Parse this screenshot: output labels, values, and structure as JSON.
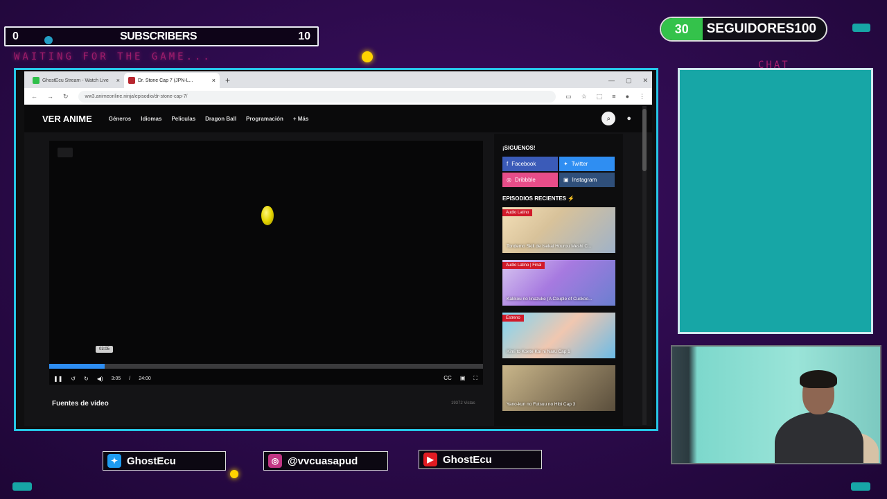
{
  "overlay": {
    "subscribers": {
      "current": "0",
      "label": "SUBSCRIBERS",
      "goal": "10"
    },
    "waiting_text": "WAITING FOR THE GAME...",
    "followers": {
      "current": "30",
      "label": "SEGUIDORES",
      "goal": "100"
    },
    "chat_label": "CHAT",
    "socials": [
      {
        "icon": "twitter-icon",
        "handle": "GhostEcu"
      },
      {
        "icon": "instagram-icon",
        "handle": "@vvcuasapud"
      },
      {
        "icon": "youtube-icon",
        "handle": "GhostEcu"
      }
    ]
  },
  "browser": {
    "tabs": [
      {
        "label": "GhostEcu Stream - Watch Live",
        "icon": "green-favicon"
      },
      {
        "label": "Dr. Stone Cap 7 (JPN-L...",
        "icon": "red-favicon"
      }
    ],
    "url": "ww3.animeonline.ninja/episodio/dr-stone-cap-7/"
  },
  "site": {
    "brand": "VER ANIME",
    "nav": [
      "Géneros",
      "Idiomas",
      "Peliculas",
      "Dragon Ball",
      "Programación",
      "+ Más"
    ],
    "player": {
      "tooltip": "03:05",
      "current_time": "3:05",
      "separator": "/",
      "duration": "24:00",
      "progress_fraction": 0.1285
    },
    "fuentes_label": "Fuentes de video",
    "views": "19372 Vistas",
    "sidebar": {
      "follow_heading": "¡SIGUENOS!",
      "social_buttons": [
        "Facebook",
        "Twitter",
        "Dribbble",
        "Instagram"
      ],
      "recent_heading": "EPISODIOS RECIENTES",
      "episodes": [
        {
          "tag": "Audio Latino",
          "title": "Tondemo Skill de Isekai Hourou Meshi C..."
        },
        {
          "tag": "Audio Latino | Final",
          "title": "Kakkou no Iinazuke (A Couple of Cuckoo..."
        },
        {
          "tag": "Estreno",
          "title": "Kimi to Koete Koi ni Naru Cap 1"
        },
        {
          "tag": "",
          "title": "Yano-kun no Futsuu no Hibi Cap 3"
        }
      ]
    }
  }
}
